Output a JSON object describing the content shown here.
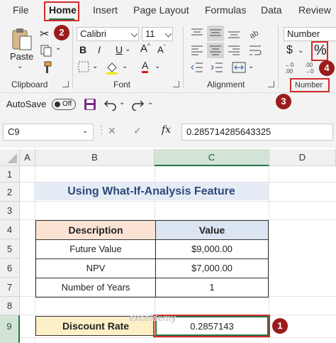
{
  "ribbon": {
    "tabs": [
      "File",
      "Home",
      "Insert",
      "Page Layout",
      "Formulas",
      "Data",
      "Review"
    ],
    "clipboard": {
      "paste_label": "Paste",
      "group_label": "Clipboard"
    },
    "font": {
      "name": "Calibri",
      "size": "11",
      "group_label": "Font",
      "bold": "B",
      "italic": "I",
      "underline": "U"
    },
    "alignment": {
      "group_label": "Alignment"
    },
    "number": {
      "format": "Number",
      "currency_symbol": "$",
      "percent_symbol": "%",
      "group_label": "Number"
    }
  },
  "qat": {
    "autosave_label": "AutoSave",
    "autosave_state": "Off"
  },
  "formula_bar": {
    "name_box": "C9",
    "fx_label": "fx",
    "formula": "0.285714285643325"
  },
  "grid": {
    "columns": [
      "A",
      "B",
      "C",
      "D"
    ],
    "rows": [
      "1",
      "2",
      "3",
      "4",
      "5",
      "6",
      "7",
      "8",
      "9"
    ],
    "title": "Using What-If-Analysis Feature",
    "table": {
      "headers": [
        "Description",
        "Value"
      ],
      "rows": [
        [
          "Future Value",
          "$9,000.00"
        ],
        [
          "NPV",
          "$7,000.00"
        ],
        [
          "Number of Years",
          "1"
        ]
      ]
    },
    "discount_rate": {
      "label": "Discount Rate",
      "value": "0.2857143"
    }
  },
  "annotations": {
    "badge1": "1",
    "badge2": "2",
    "badge3": "3",
    "badge4": "4"
  },
  "watermark": "exceldemy",
  "colors": {
    "accent": "#217346",
    "highlight": "#d42b2b",
    "badge": "#9b1c1c"
  }
}
